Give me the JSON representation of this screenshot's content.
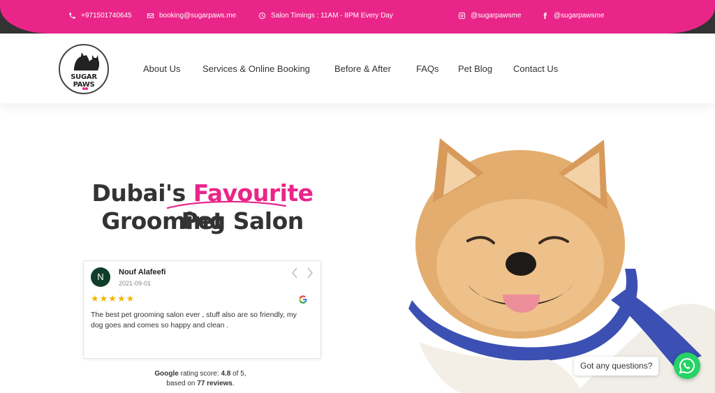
{
  "topbar": {
    "phone": "+971501740645",
    "email": "booking@sugarpaws.me",
    "timings": "Salon Timings : 11AM - 8PM Every Day",
    "instagram": "@sugarpawsme",
    "facebook": "@sugarpawsme"
  },
  "logo": {
    "text": "SUGAR PAWS"
  },
  "nav": {
    "about": "About Us",
    "services": "Services & Online Booking",
    "before_after": "Before & After",
    "faqs": "FAQs",
    "blog": "Pet Blog",
    "contact": "Contact Us"
  },
  "hero": {
    "title_part1": "Dubai's ",
    "title_accent": "Favourite",
    "title_part2": " Pet",
    "title_line2": "Grooming Salon"
  },
  "review": {
    "initial": "N",
    "name": "Nouf Alafeefi",
    "date": "2021-09-01",
    "stars": "★★★★★",
    "rating_value": 5,
    "text": "The best pet grooming salon ever , stuff also are so friendly, my dog goes and comes so happy and clean ."
  },
  "rating_summary": {
    "source": "Google",
    "label": " rating score: ",
    "score": "4.8",
    "of": " of 5,",
    "based_on": "based on ",
    "count": "77 reviews",
    "period": "."
  },
  "chat": {
    "label": "Got any questions?"
  },
  "colors": {
    "accent": "#ea258a",
    "whatsapp": "#25d366",
    "avatar": "#0f3e2b"
  },
  "icons": [
    "phone-icon",
    "mail-icon",
    "clock-icon",
    "instagram-icon",
    "facebook-icon",
    "chevron-left-icon",
    "chevron-right-icon",
    "google-icon",
    "whatsapp-icon"
  ]
}
